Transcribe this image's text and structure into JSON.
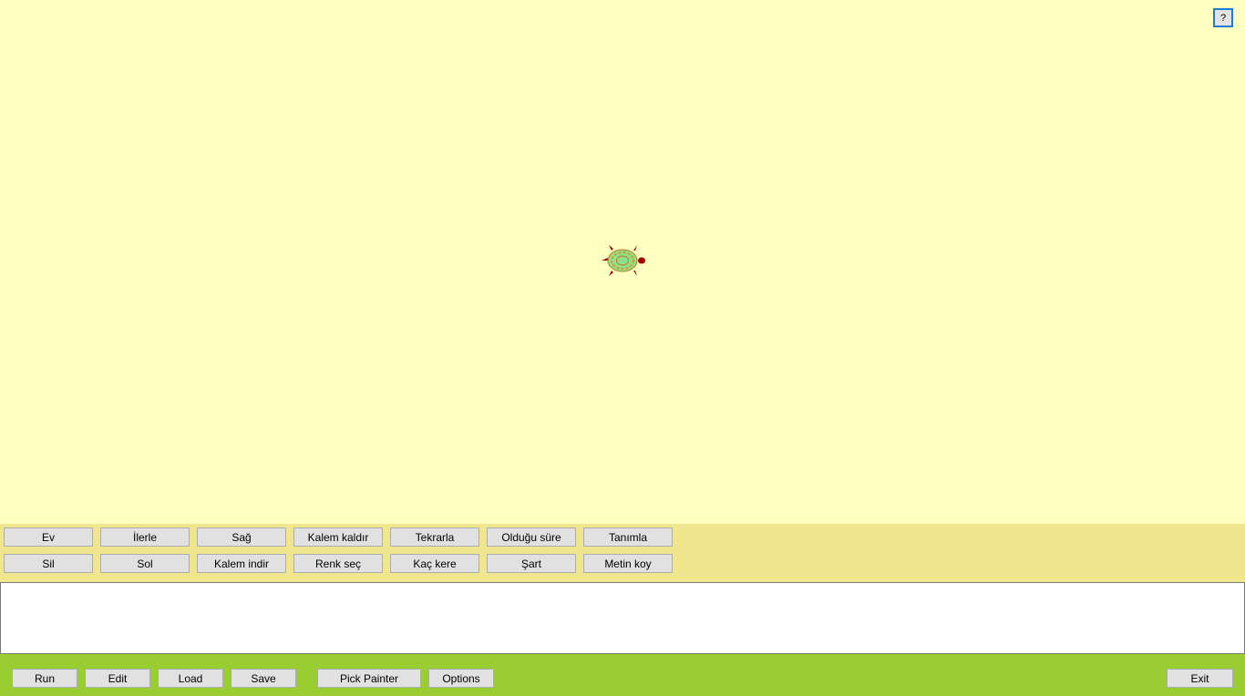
{
  "canvas": {
    "background": "#ffffc1",
    "help_label": "?",
    "turtle_icon": "turtle-icon"
  },
  "commands": {
    "row1": [
      {
        "label": "Ev"
      },
      {
        "label": "İlerle"
      },
      {
        "label": "Sağ"
      },
      {
        "label": "Kalem kaldır"
      },
      {
        "label": "Tekrarla"
      },
      {
        "label": "Olduğu süre"
      },
      {
        "label": "Tanımla"
      }
    ],
    "row2": [
      {
        "label": "Sil"
      },
      {
        "label": "Sol"
      },
      {
        "label": "Kalem indir"
      },
      {
        "label": "Renk seç"
      },
      {
        "label": "Kaç kere"
      },
      {
        "label": "Şart"
      },
      {
        "label": "Metin koy"
      }
    ]
  },
  "editor": {
    "value": ""
  },
  "toolbar": {
    "run_label": "Run",
    "edit_label": "Edit",
    "load_label": "Load",
    "save_label": "Save",
    "pick_painter_label": "Pick Painter",
    "options_label": "Options",
    "exit_label": "Exit"
  },
  "colors": {
    "canvas": "#ffffc1",
    "command_panel": "#efe68d",
    "bottom_bar": "#9acd32",
    "turtle_shell": "#8fe08a",
    "turtle_body": "#a00000"
  }
}
